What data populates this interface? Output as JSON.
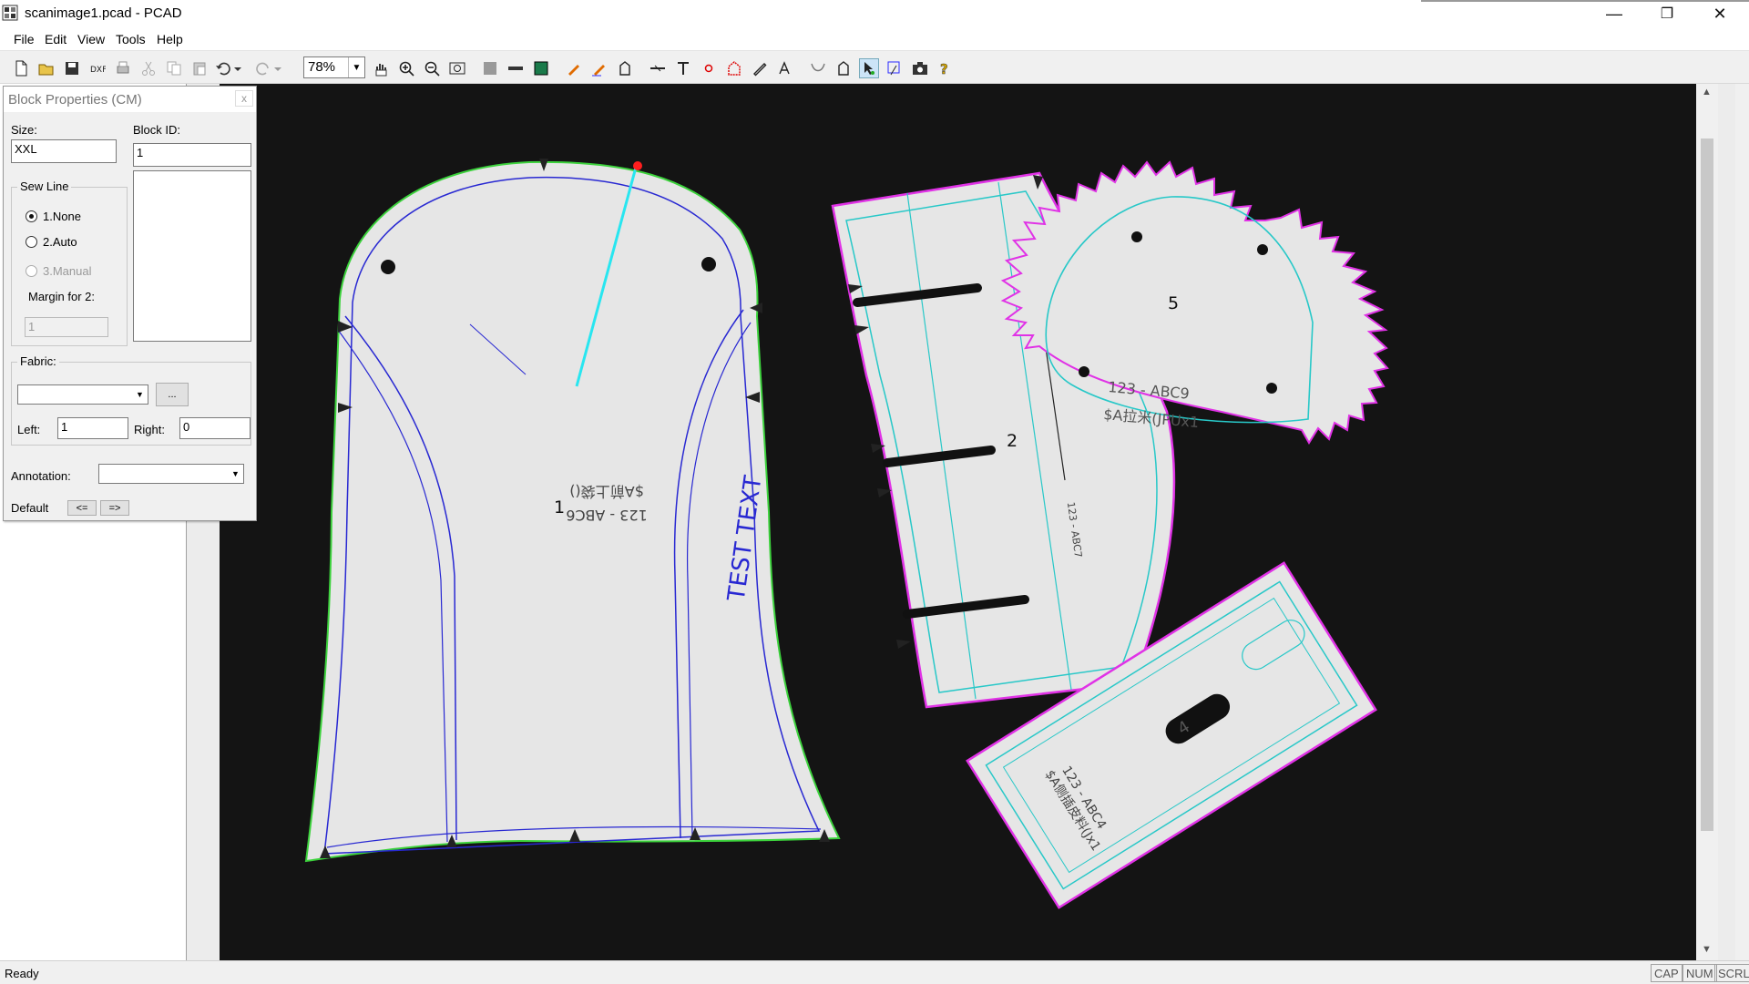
{
  "window": {
    "title": "scanimage1.pcad - PCAD",
    "minimize_glyph": "—",
    "maximize_glyph": "❐",
    "close_glyph": "✕"
  },
  "menu": [
    "File",
    "Edit",
    "View",
    "Tools",
    "Help"
  ],
  "toolbar": {
    "zoom_value": "78%",
    "icons": [
      "new-file-icon",
      "open-folder-icon",
      "save-icon",
      "dxf-export-icon",
      "print-icon",
      "cut-icon",
      "copy-icon",
      "paste-icon",
      "undo-icon",
      "undo-dropdown-icon",
      "redo-icon",
      "redo-dropdown-icon",
      "zoom-select",
      "pan-hand-icon",
      "zoom-in-icon",
      "zoom-out-icon",
      "zoom-fit-icon",
      "fill-gray-icon",
      "measure-ruler-icon",
      "scan-image-icon",
      "pen-edit-icon",
      "pen-line-icon",
      "piece-outline-icon",
      "notch-tool-icon",
      "text-tool-icon",
      "point-tool-icon",
      "shape-tool-icon",
      "pencil-icon",
      "annotation-text-icon",
      "curve-tool-icon",
      "block-tool-icon",
      "select-arrow-icon",
      "grading-icon",
      "camera-icon",
      "help-icon"
    ]
  },
  "panel": {
    "title": "Block Properties",
    "unit": "(CM)",
    "close_glyph": "x",
    "size_label": "Size:",
    "size_value": "XXL",
    "block_id_label": "Block ID:",
    "block_id_value": "1",
    "sew_line": {
      "label": "Sew Line",
      "options": [
        "1.None",
        "2.Auto",
        "3.Manual"
      ],
      "selected": "1.None",
      "margin_label": "Margin for 2:",
      "margin_value": "1"
    },
    "fabric": {
      "label": "Fabric:",
      "browse_label": "...",
      "left_label": "Left:",
      "left_value": "1",
      "right_label": "Right:",
      "right_value": "0"
    },
    "annotation_label": "Annotation:",
    "default_label": "Default",
    "prev_label": "<=",
    "next_label": "=>"
  },
  "canvas": {
    "pieces": [
      {
        "number": "1",
        "code": "123 - ABC6",
        "name": "$A前上袋()",
        "side_text": "TEST TEXT"
      },
      {
        "number": "2",
        "code": "123 - ABC7"
      },
      {
        "number": "4",
        "code": "123 - ABC4",
        "name": "$A侧插皮料(Jx1"
      },
      {
        "number": "5",
        "code": "123 - ABC9",
        "name": "$A拉米(JPUx1"
      }
    ]
  },
  "status": {
    "text": "Ready",
    "indicators": [
      "CAP",
      "NUM",
      "SCRL"
    ]
  },
  "colors": {
    "canvas_bg": "#141414",
    "piece_fill": "#e8e8e8",
    "outline_green": "#3cd23c",
    "outline_magenta": "#e032e6",
    "seam_blue": "#2828d2",
    "seam_cyan": "#28c8c8",
    "grain_cyan": "#28e6f0",
    "point_red": "#ff1e1e"
  }
}
